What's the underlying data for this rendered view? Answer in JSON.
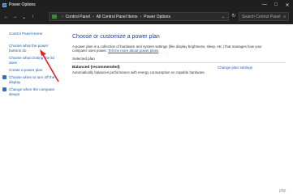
{
  "window": {
    "title": "Power Options",
    "controls": {
      "minimize": "—",
      "maximize": "□",
      "close": "✕"
    }
  },
  "nav": {
    "back": "←",
    "forward": "→",
    "down": "⌄",
    "up": "↑",
    "breadcrumb": [
      "Control Panel",
      "All Control Panel Items",
      "Power Options"
    ],
    "breadcrumb_separator": "›",
    "dropdown": "⌄",
    "refresh": "↻",
    "search_placeholder": "Search Control Panel",
    "search_icon": "⌕"
  },
  "left_pane": {
    "items": [
      {
        "label": "Control Panel Home"
      },
      {
        "label": "Choose what the power buttons do"
      },
      {
        "label": "Choose what closing the lid does"
      },
      {
        "label": "Create a power plan"
      },
      {
        "label": "Choose when to turn off the display"
      },
      {
        "label": "Change when the computer sleeps"
      }
    ]
  },
  "main": {
    "heading": "Choose or customize a power plan",
    "description": "A power plan is a collection of hardware and system settings (like display brightness, sleep, etc.) that manages how your computer uses power.",
    "description_link": "Tell me more about power plans",
    "selected_header": "Selected plan",
    "plan_name": "Balanced (recommended)",
    "plan_desc": "Automatically balances performance with energy consumption on capable hardware.",
    "plan_link": "Change plan settings"
  },
  "watermark": "php",
  "colors": {
    "accent_link": "#1a5fb4",
    "heading": "#1e3f86",
    "titlebar": "#1f1f1f",
    "annotation_arrow": "#e02020"
  }
}
